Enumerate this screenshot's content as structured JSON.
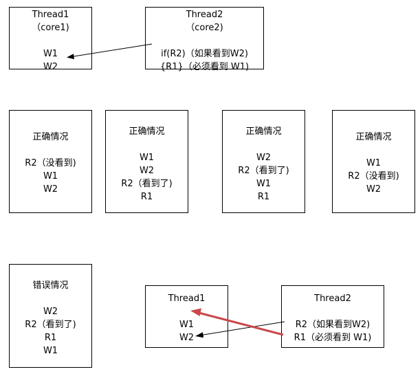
{
  "top": {
    "thread1": {
      "title": "Thread1",
      "core": "（core1)",
      "lines": [
        "W1",
        "W2"
      ]
    },
    "thread2": {
      "title": "Thread2",
      "core": "（core2)",
      "lines": [
        "if(R2)（如果看到W2)",
        "{R1}（必须看到 W1)"
      ]
    }
  },
  "cases": [
    {
      "heading": "正确情况",
      "lines": [
        "R2（没看到)",
        "W1",
        "W2"
      ]
    },
    {
      "heading": "正确情况",
      "lines": [
        "W1",
        "W2",
        "R2（看到了)",
        "R1"
      ]
    },
    {
      "heading": "正确情况",
      "lines": [
        "W2",
        "R2（看到了)",
        "W1",
        "R1"
      ]
    },
    {
      "heading": "正确情况",
      "lines": [
        "W1",
        "R2（没看到)",
        "W2"
      ]
    }
  ],
  "error_case": {
    "heading": "错误情况",
    "lines": [
      "W2",
      "R2（看到了)",
      "R1",
      "W1"
    ]
  },
  "bottom": {
    "thread1": {
      "title": "Thread1",
      "lines": [
        "W1",
        "W2"
      ]
    },
    "thread2": {
      "title": "Thread2",
      "lines": [
        "R2（如果看到W2)",
        "R1（必须看到 W1)"
      ]
    }
  },
  "colors": {
    "stroke": "#000000",
    "highlight": "#c9474a"
  }
}
